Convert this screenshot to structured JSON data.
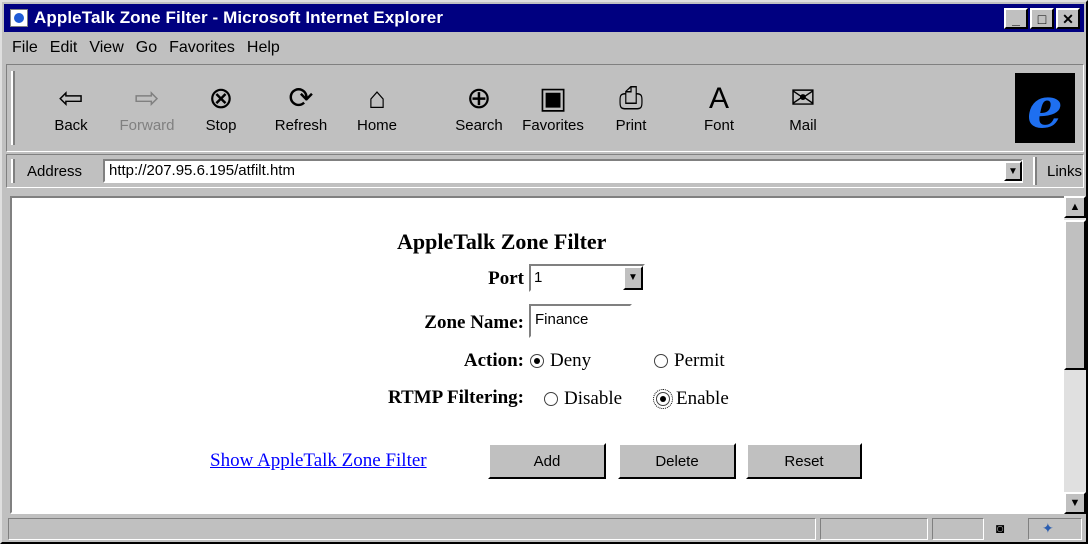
{
  "window": {
    "title": "AppleTalk Zone Filter - Microsoft Internet Explorer"
  },
  "menu": [
    "File",
    "Edit",
    "View",
    "Go",
    "Favorites",
    "Help"
  ],
  "toolbar": {
    "back": "Back",
    "forward": "Forward",
    "stop": "Stop",
    "refresh": "Refresh",
    "home": "Home",
    "search": "Search",
    "favorites": "Favorites",
    "print": "Print",
    "font": "Font",
    "mail": "Mail"
  },
  "address": {
    "label": "Address",
    "url": "http://207.95.6.195/atfilt.htm",
    "links": "Links"
  },
  "form": {
    "title": "AppleTalk Zone Filter",
    "port_label": "Port",
    "port_value": "1",
    "zone_label": "Zone Name:",
    "zone_value": "Finance",
    "action_label": "Action:",
    "action_options": [
      "Deny",
      "Permit"
    ],
    "action_selected": "Deny",
    "rtmp_label": "RTMP Filtering:",
    "rtmp_options": [
      "Disable",
      "Enable"
    ],
    "rtmp_selected": "Enable",
    "show_link": "Show AppleTalk Zone Filter",
    "buttons": {
      "add": "Add",
      "delete": "Delete",
      "reset": "Reset"
    }
  },
  "icons": [
    "back-arrow-icon",
    "forward-arrow-icon",
    "stop-icon",
    "refresh-icon",
    "home-icon",
    "search-icon",
    "favorites-icon",
    "print-icon",
    "font-icon",
    "mail-icon",
    "ie-logo",
    "internet-zone-icon"
  ]
}
